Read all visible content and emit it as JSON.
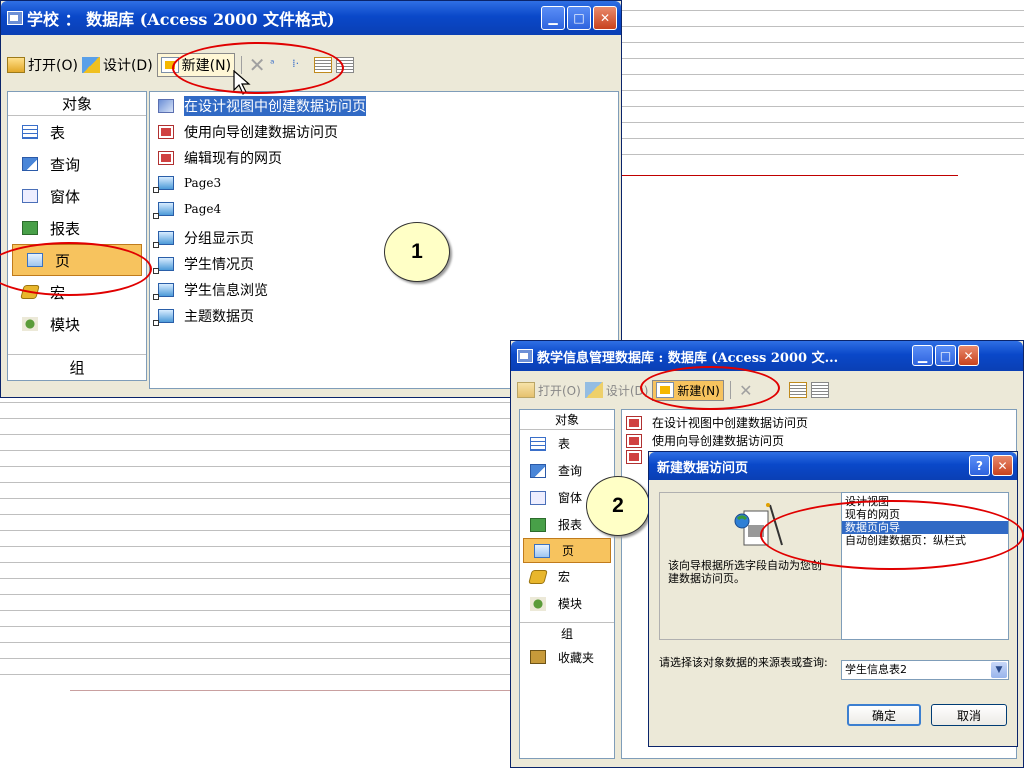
{
  "window1": {
    "title": "学校 ： 数据库 (Access 2000 文件格式)",
    "toolbar": {
      "open": "打开(O)",
      "design": "设计(D)",
      "new": "新建(N)"
    },
    "objects_header": "对象",
    "objects": [
      "表",
      "查询",
      "窗体",
      "报表",
      "页",
      "宏",
      "模块"
    ],
    "groups_label": "组",
    "list_items": [
      "在设计视图中创建数据访问页",
      "使用向导创建数据访问页",
      "编辑现有的网页",
      "Page3",
      "Page4",
      "分组显示页",
      "学生情况页",
      "学生信息浏览",
      "主题数据页"
    ],
    "selected_item_index": 0,
    "selected_object": "页"
  },
  "marker1": "1",
  "window2": {
    "title": "教学信息管理数据库 : 数据库 (Access 2000 文...",
    "toolbar": {
      "open": "打开(O)",
      "design": "设计(D)",
      "new": "新建(N)"
    },
    "objects_header": "对象",
    "objects": [
      "表",
      "查询",
      "窗体",
      "报表",
      "页",
      "宏",
      "模块"
    ],
    "groups_label": "组",
    "favorites": "收藏夹",
    "list_items": [
      "在设计视图中创建数据访问页",
      "使用向导创建数据访问页"
    ]
  },
  "marker2": "2",
  "dialog": {
    "title": "新建数据访问页",
    "help": "?",
    "description": "该向导根据所选字段自动为您创建数据访问页。",
    "options": [
      "设计视图",
      "现有的网页",
      "数据页向导",
      "自动创建数据页：纵栏式"
    ],
    "selected_option_index": 2,
    "source_label": "请选择该对象数据的来源表或查询:",
    "source_value": "学生信息表2",
    "ok": "确定",
    "cancel": "取消"
  },
  "colors": {
    "highlight": "#f7c35e",
    "annotation_red": "#e00000",
    "xp_blue": "#0a48c9"
  }
}
